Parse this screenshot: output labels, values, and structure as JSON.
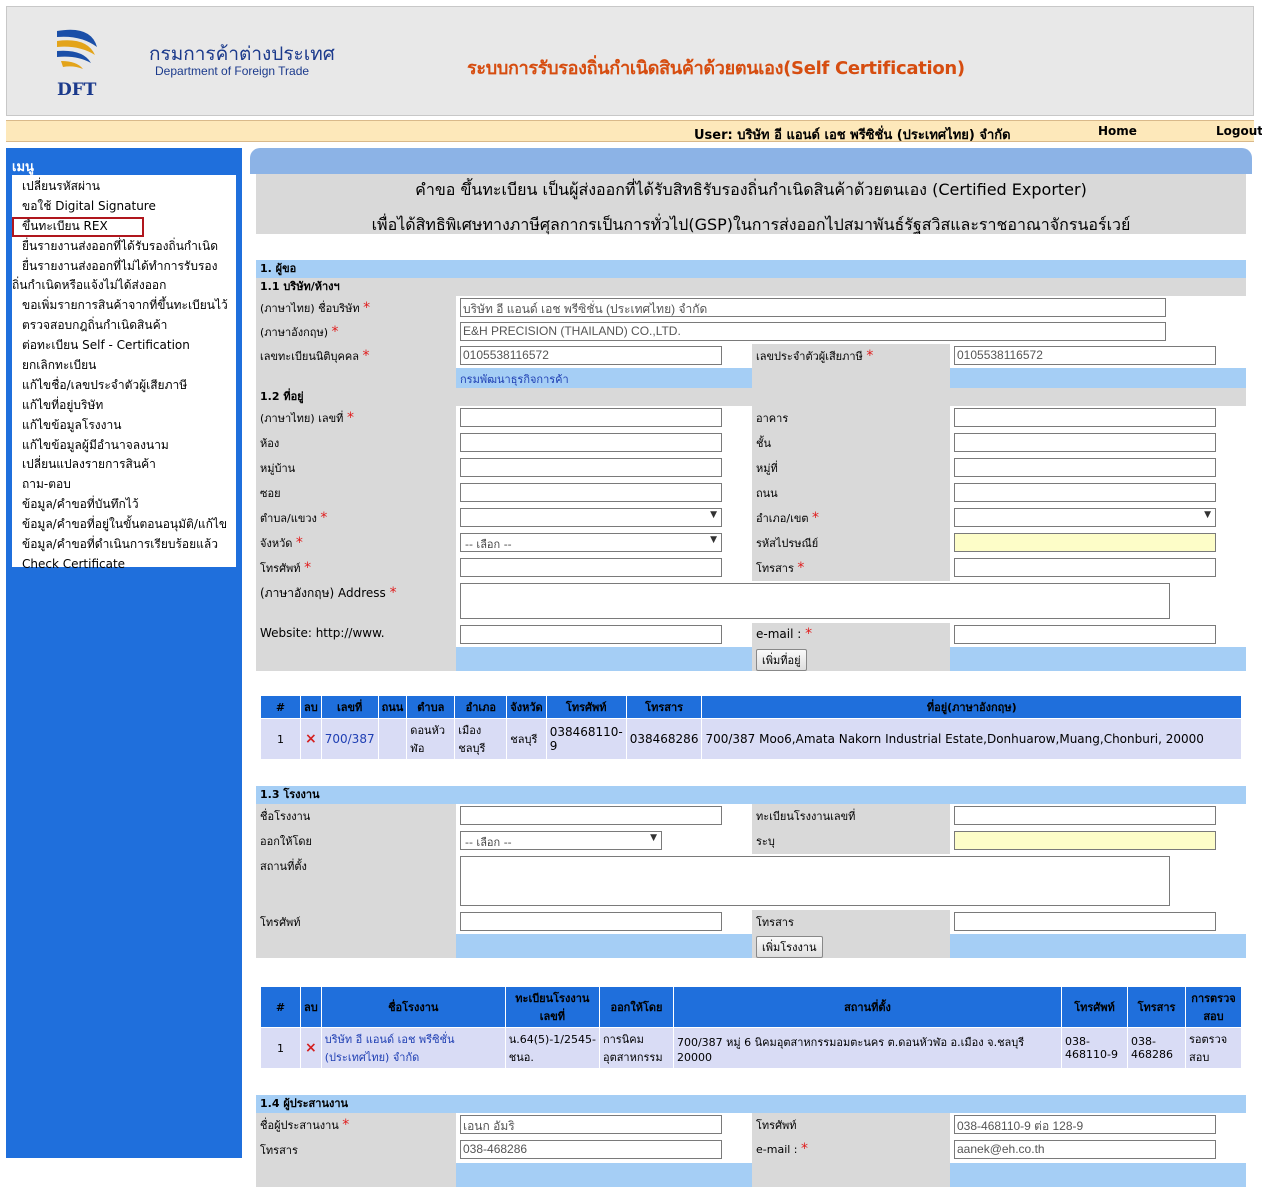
{
  "header": {
    "org_th": "กรมการค้าต่างประเทศ",
    "org_en": "Department of Foreign Trade",
    "logo_text": "DFT",
    "system_title": "ระบบการรับรองถิ่นกำเนิดสินค้าด้วยตนเอง(Self Certification)"
  },
  "userbar": {
    "user": "User: บริษัท อี แอนด์ เอช พรีซิชั่น (ประเทศไทย) จำกัด",
    "home": "Home",
    "logout": "Logout"
  },
  "sidebar": {
    "title": "เมนู",
    "items": [
      "เปลี่ยนรหัสผ่าน",
      "ขอใช้ Digital Signature",
      "ขึ้นทะเบียน REX",
      "ยื่นรายงานส่งออกที่ได้รับรองถิ่นกำเนิด",
      "ยื่นรายงานส่งออกที่ไม่ได้ทำการรับรอง",
      "ถิ่นกำเนิดหรือแจ้งไม่ได้ส่งออก",
      "ขอเพิ่มรายการสินค้าจากที่ขึ้นทะเบียนไว้",
      "ตรวจสอบกฎถิ่นกำเนิดสินค้า",
      "ต่อทะเบียน Self - Certification",
      "ยกเลิกทะเบียน",
      "แก้ไขชื่อ/เลขประจำตัวผู้เสียภาษี",
      "แก้ไขที่อยู่บริษัท",
      "แก้ไขข้อมูลโรงงาน",
      "แก้ไขข้อมูลผู้มีอำนาจลงนาม",
      "เปลี่ยนแปลงรายการสินค้า",
      "ถาม-ตอบ",
      "ข้อมูล/คำขอที่บันทึกไว้",
      "ข้อมูล/คำขอที่อยู่ในขั้นตอนอนุมัติ/แก้ไข",
      "ข้อมูล/คำขอที่ดำเนินการเรียบร้อยแล้ว",
      "Check Certificate"
    ],
    "selected_index": 2
  },
  "form": {
    "title_line1": "คำขอ ขึ้นทะเบียน เป็นผู้ส่งออกที่ได้รับสิทธิรับรองถิ่นกำเนิดสินค้าด้วยตนเอง (Certified Exporter)",
    "title_line2": "เพื่อได้สิทธิพิเศษทางภาษีศุลกากรเป็นการทั่วไป(GSP)ในการส่งออกไปสมาพันธ์รัฐสวิสและราชอาณาจักรนอร์เวย์",
    "section1": "1. ผู้ขอ",
    "section1_1": "1.1 บริษัท/ห้างฯ",
    "name_th_label": "(ภาษาไทย) ชื่อบริษัท",
    "name_th_value": "บริษัท อี แอนด์ เอช พรีซิชั่น (ประเทศไทย) จำกัด",
    "name_en_label": "(ภาษาอังกฤษ)",
    "name_en_value": "E&H PRECISION (THAILAND) CO.,LTD.",
    "reg_no_label": "เลขทะเบียนนิติบุคคล",
    "reg_no_value": "0105538116572",
    "tax_no_label": "เลขประจำตัวผู้เสียภาษี",
    "tax_no_value": "0105538116572",
    "dbd_link": "กรมพัฒนาธุรกิจการค้า",
    "section1_2": "1.2 ที่อยู่",
    "addr_no_label": "(ภาษาไทย) เลขที่",
    "building_label": "อาคาร",
    "room_label": "ห้อง",
    "floor_label": "ชั้น",
    "village_label": "หมู่บ้าน",
    "moo_label": "หมู่ที่",
    "soi_label": "ซอย",
    "road_label": "ถนน",
    "subdistrict_label": "ตำบล/แขวง",
    "district_label": "อำเภอ/เขต",
    "province_label": "จังหวัด",
    "province_value": "-- เลือก --",
    "postcode_label": "รหัสไปรษณีย์",
    "phone_label": "โทรศัพท์",
    "fax_label": "โทรสาร",
    "addr_en_label": "(ภาษาอังกฤษ) Address",
    "website_label": "Website: http://www.",
    "email_label": "e-mail :",
    "add_address_btn": "เพิ่มที่อยู่",
    "section1_3": "1.3 โรงงาน",
    "factory_name_label": "ชื่อโรงงาน",
    "factory_reg_label": "ทะเบียนโรงงานเลขที่",
    "issued_by_label": "ออกให้โดย",
    "issued_by_value": "-- เลือก --",
    "specify_label": "ระบุ",
    "location_label": "สถานที่ตั้ง",
    "factory_phone_label": "โทรศัพท์",
    "factory_fax_label": "โทรสาร",
    "add_factory_btn": "เพิ่มโรงงาน",
    "section1_4": "1.4 ผู้ประสานงาน",
    "coord_name_label": "ชื่อผู้ประสานงาน",
    "coord_name_value": "เอนก อัมริ",
    "coord_phone_label": "โทรศัพท์",
    "coord_phone_value": "038-468110-9 ต่อ 128-9",
    "coord_fax_label": "โทรสาร",
    "coord_fax_value": "038-468286",
    "coord_email_label": "e-mail :",
    "coord_email_value": "aanek@eh.co.th"
  },
  "address_table": {
    "headers": [
      "#",
      "ลบ",
      "เลขที่",
      "ถนน",
      "ตำบล",
      "อำเภอ",
      "จังหวัด",
      "โทรศัพท์",
      "โทรสาร",
      "ที่อยู่(ภาษาอังกฤษ)"
    ],
    "rows": [
      [
        "1",
        "×",
        "700/387",
        "",
        "ดอนหัวฬ่อ",
        "เมืองชลบุรี",
        "ชลบุรี",
        "038468110-9",
        "038468286",
        "700/387 Moo6,Amata Nakorn Industrial Estate,Donhuarow,Muang,Chonburi, 20000"
      ]
    ]
  },
  "factory_table": {
    "headers": [
      "#",
      "ลบ",
      "ชื่อโรงงาน",
      "ทะเบียนโรงงานเลขที่",
      "ออกให้โดย",
      "สถานที่ตั้ง",
      "โทรศัพท์",
      "โทรสาร",
      "การตรวจสอบ"
    ],
    "rows": [
      [
        "1",
        "×",
        "บริษัท อี แอนด์ เอช พรีซิชั่น (ประเทศไทย) จำกัด",
        "น.64(5)-1/2545-ชนอ.",
        "การนิคมอุตสาหกรรม",
        "700/387 หมู่ 6 นิคมอุตสาหกรรมอมตะนคร ต.ดอนหัวฬ่อ อ.เมือง จ.ชลบุรี 20000",
        "038-468110-9",
        "038-468286",
        "รอตรวจสอบ"
      ]
    ]
  },
  "colors": {
    "accent_blue": "#1f6fdc",
    "section_blue": "#a5cef5",
    "title_orange": "#d64d10",
    "required_red": "#e01b1b"
  }
}
